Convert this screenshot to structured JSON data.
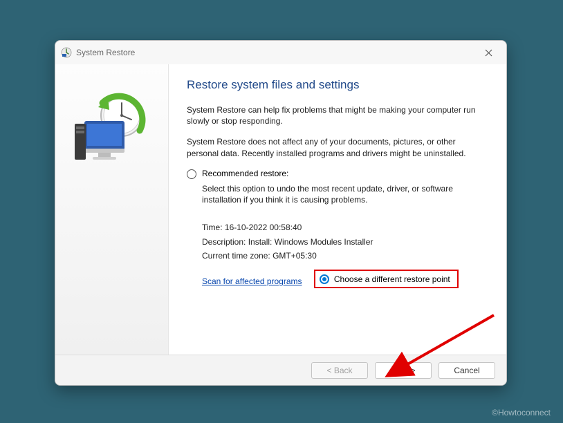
{
  "window": {
    "title": "System Restore"
  },
  "main": {
    "heading": "Restore system files and settings",
    "intro1": "System Restore can help fix problems that might be making your computer run slowly or stop responding.",
    "intro2": "System Restore does not affect any of your documents, pictures, or other personal data. Recently installed programs and drivers might be uninstalled.",
    "recommended": {
      "label": "Recommended restore:",
      "desc": "Select this option to undo the most recent update, driver, or software installation if you think it is causing problems.",
      "time_label": "Time:",
      "time_value": "16-10-2022 00:58:40",
      "desc_label": "Description:",
      "desc_value": "Install: Windows Modules Installer",
      "tz_label": "Current time zone:",
      "tz_value": "GMT+05:30"
    },
    "scan_link": "Scan for affected programs",
    "choose_different": "Choose a different restore point"
  },
  "buttons": {
    "back": "< Back",
    "next": "Next >",
    "cancel": "Cancel"
  },
  "watermark": "©Howtoconnect"
}
